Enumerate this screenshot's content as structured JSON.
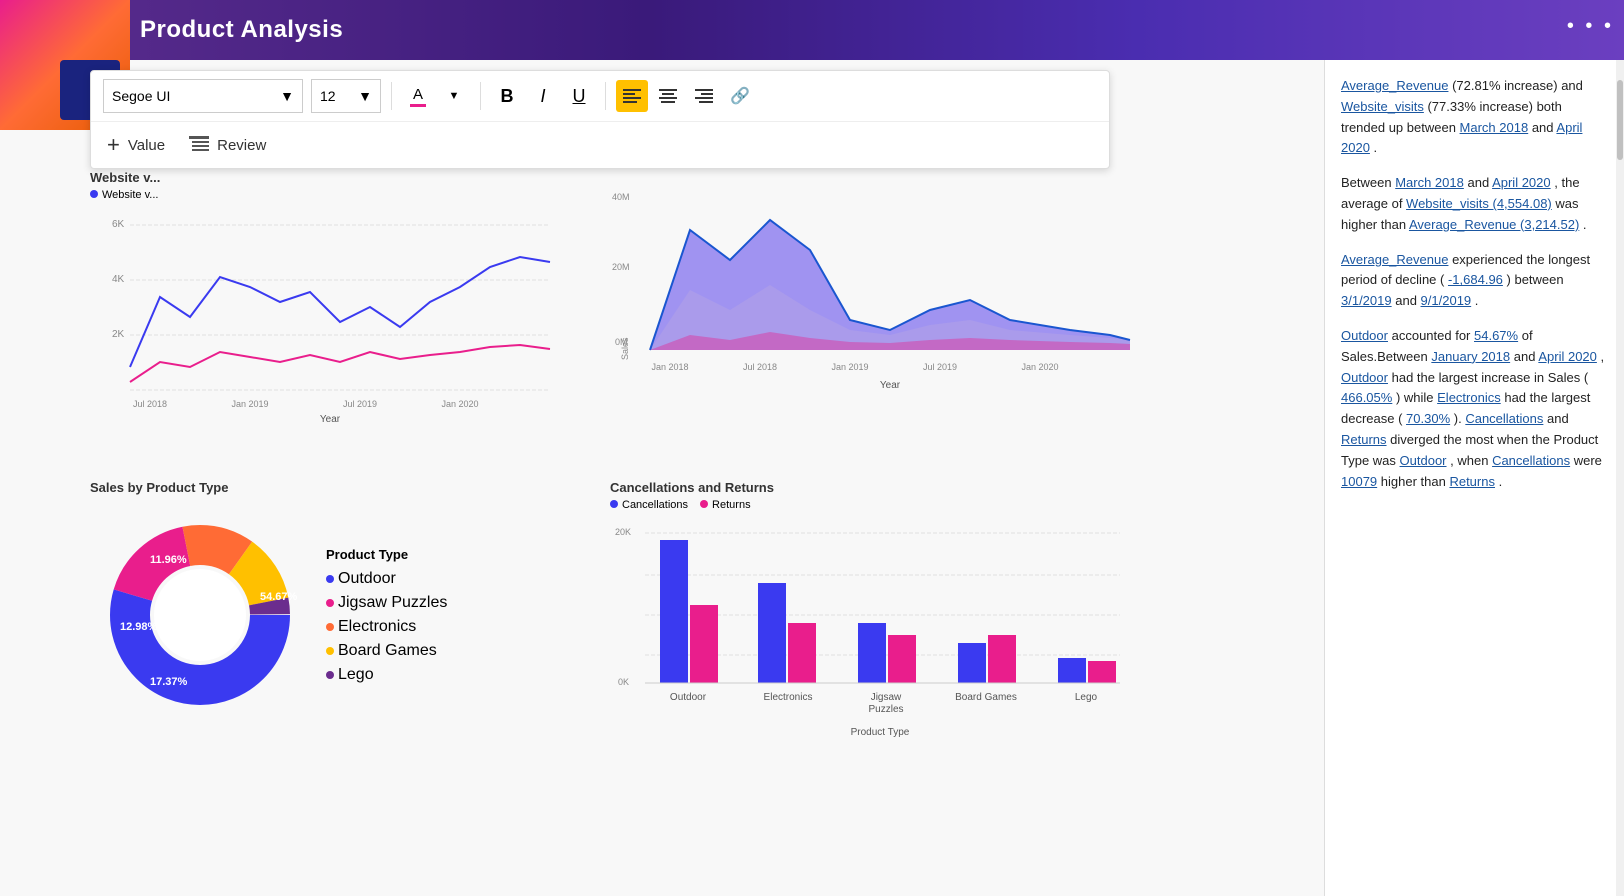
{
  "header": {
    "title": "Product Analysis"
  },
  "toolbar": {
    "font_family": "Segoe UI",
    "font_size": "12",
    "add_value_label": "Value",
    "review_label": "Review"
  },
  "charts": {
    "website_visits_title": "Website v...",
    "website_visits_legend": [
      "Website v..."
    ],
    "sales_title": "Sales",
    "sales_legend": [],
    "product_type_title": "Sales by Product Type",
    "product_type_legend_title": "Product Type",
    "product_type_items": [
      {
        "label": "Outdoor",
        "color": "#3a3af0",
        "pct": "54.67%"
      },
      {
        "label": "Jigsaw Puzzles",
        "color": "#e91e8c",
        "pct": "17.37%"
      },
      {
        "label": "Electronics",
        "color": "#ff6b35",
        "pct": "12.98%"
      },
      {
        "label": "Board Games",
        "color": "#ffc000",
        "pct": "11.96%"
      },
      {
        "label": "Lego",
        "color": "#6b2d8e",
        "pct": ""
      }
    ],
    "cancellations_title": "Cancellations and Returns",
    "cancellations_legend": [
      {
        "label": "Cancellations",
        "color": "#3a3af0"
      },
      {
        "label": "Returns",
        "color": "#e91e8c"
      }
    ],
    "cancellations_categories": [
      "Outdoor",
      "Electronics",
      "Jigsaw Puzzles",
      "Board Games",
      "Lego"
    ],
    "x_axis_label_year": "Year",
    "x_axis_label_product": "Product Type"
  },
  "insights": {
    "paragraph1": "Average_Revenue (72.81% increase) and Website_visits (77.33% increase) both trended up between March 2018 and April 2020.",
    "paragraph2": "Between March 2018 and April 2020, the average of Website_visits (4,554.08) was higher than Average_Revenue (3,214.52).",
    "paragraph3": "Average_Revenue experienced the longest period of decline (-1,684.96) between 3/1/2019 and 9/1/2019.",
    "paragraph4": "Outdoor accounted for 54.67% of Sales.Between January 2018 and April 2020, Outdoor had the largest increase in Sales (466.05%) while Electronics had the largest decrease (70.30%). Cancellations and Returns diverged the most when the Product Type was Outdoor, when Cancellations were 10079 higher than Returns."
  },
  "colors": {
    "accent_blue": "#3a3af0",
    "accent_pink": "#e91e8c",
    "accent_orange": "#ff6b35",
    "accent_yellow": "#ffc000",
    "accent_purple": "#6b2d8e",
    "header_bg": "#4a2db0",
    "logo_gradient_start": "#e91e8c",
    "logo_gradient_end": "#e65c00"
  }
}
